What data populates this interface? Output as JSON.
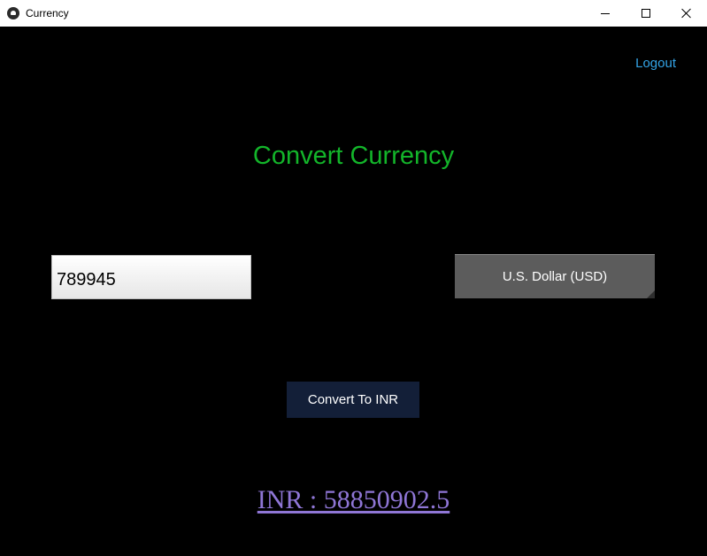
{
  "window": {
    "title": "Currency",
    "icon": "kivy-logo-icon",
    "controls": [
      "minimize-icon",
      "maximize-icon",
      "close-icon"
    ]
  },
  "header": {
    "logout_label": "Logout",
    "heading": "Convert Currency"
  },
  "form": {
    "amount_value": "789945",
    "currency_selected": "U.S. Dollar (USD)",
    "convert_label": "Convert To INR"
  },
  "result": {
    "text": "INR : 58850902.5"
  },
  "colors": {
    "background": "#000000",
    "heading": "#13b52a",
    "logout_link": "#33a3e6",
    "result_link": "#8f76d6",
    "convert_button": "#131f38",
    "currency_dropdown": "#5c5c5c"
  }
}
